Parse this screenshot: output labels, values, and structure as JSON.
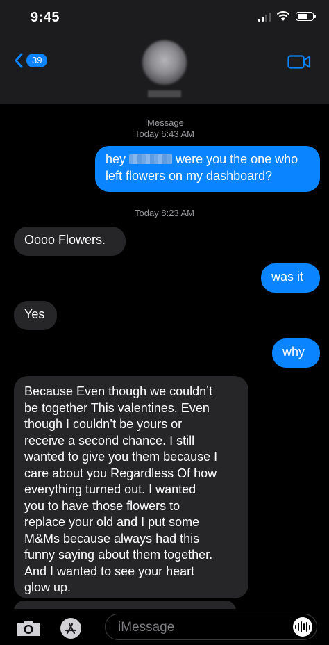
{
  "status_bar": {
    "time": "9:45"
  },
  "header": {
    "back_count": "39"
  },
  "conversation": {
    "service_label": "iMessage",
    "timestamp_1": "Today 6:43 AM",
    "timestamp_2": "Today 8:23 AM",
    "messages": [
      {
        "from": "me",
        "text_before": "hey",
        "text_after": "were you the one who",
        "line2": "left flowers on my dashboard?"
      },
      {
        "from": "them",
        "text": "Oooo Flowers."
      },
      {
        "from": "me",
        "text": "was it"
      },
      {
        "from": "them",
        "text": "Yes"
      },
      {
        "from": "me",
        "text": "why"
      },
      {
        "from": "them",
        "lines": [
          "Because Even though we couldn’t",
          "be together This valentines. Even",
          "though I couldn’t be yours or",
          "receive a second chance. I still",
          "wanted to give you them because I",
          "care about you Regardless Of how",
          "everything turned out. I wanted",
          "you to have those flowers to",
          "replace your old and I put some",
          "M&Ms because always had this",
          "funny saying about them together.",
          "And I wanted to see your heart",
          "glow up."
        ]
      }
    ]
  },
  "input_bar": {
    "placeholder": "iMessage"
  },
  "colors": {
    "outgoing_bubble": "#0a84ff",
    "incoming_bubble": "#262628",
    "background": "#000000"
  }
}
